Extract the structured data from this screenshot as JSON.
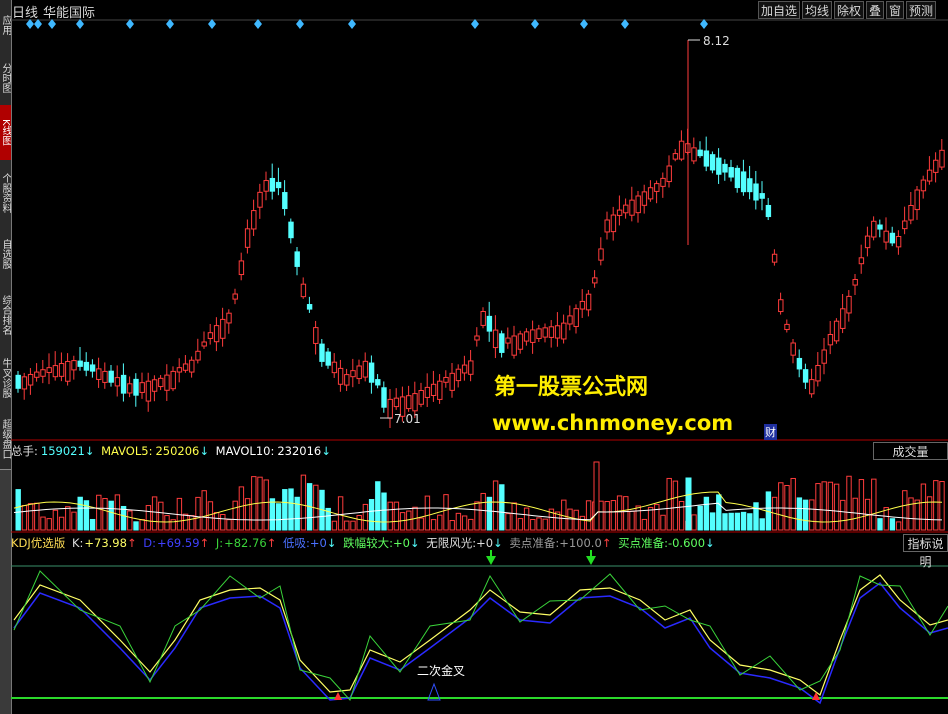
{
  "sidebar": {
    "tabs": [
      {
        "label": "应用",
        "active": false
      },
      {
        "label": "分时图",
        "active": false
      },
      {
        "label": "K线图",
        "active": true
      },
      {
        "label": "个股资料",
        "active": false
      },
      {
        "label": "自选股",
        "active": false
      },
      {
        "label": "综合排名",
        "active": false
      },
      {
        "label": "牛叉诊股",
        "active": false
      },
      {
        "label": "超级盘口",
        "active": false
      }
    ]
  },
  "header": {
    "period": "日线",
    "stock_name": "华能国际",
    "buttons": [
      "加自选",
      "均线",
      "除权",
      "叠",
      "窗",
      "预测"
    ]
  },
  "price_panel": {
    "high_label": "8.12",
    "low_label": "7.01",
    "finance_marker": "财",
    "watermark_cn": "第一股票公式网",
    "watermark_url": "www.chnmoney.com"
  },
  "volume_panel": {
    "label_total": "总手:",
    "total_value": "159021",
    "total_arrow": "↓",
    "label_ma5": "MAVOL5:",
    "ma5_value": "250206",
    "ma5_arrow": "↓",
    "label_ma10": "MAVOL10:",
    "ma10_value": "232016",
    "ma10_arrow": "↓",
    "button": "成交量"
  },
  "kdj_panel": {
    "name": "KDJ优选版",
    "k_label": "K:",
    "k_value": "+73.98",
    "k_arrow": "↑",
    "d_label": "D:",
    "d_value": "+69.59",
    "d_arrow": "↑",
    "j_label": "J:",
    "j_value": "+82.76",
    "j_arrow": "↑",
    "low_label": "低吸:",
    "low_value": "+0",
    "low_arrow": "↓",
    "drop_label": "跌幅较大:",
    "drop_value": "+0",
    "drop_arrow": "↓",
    "glory_label": "无限风光:",
    "glory_value": "+0",
    "glory_arrow": "↓",
    "sell_label": "卖点准备:",
    "sell_value": "+100.0",
    "sell_arrow": "↑",
    "buy_label": "买点准备:",
    "buy_value": "-0.600",
    "buy_arrow": "↓",
    "annotation": "二次金叉",
    "button": "指标说明"
  },
  "colors": {
    "up": "#ff3c3c",
    "down": "#54ffff",
    "ma5": "#ffff4c",
    "ma10": "#ffffff",
    "k_line": "#ffff66",
    "d_line": "#2a2aff",
    "j_line": "#3ad33a",
    "watermark": "#ffee00",
    "grid": "#b00000"
  }
}
